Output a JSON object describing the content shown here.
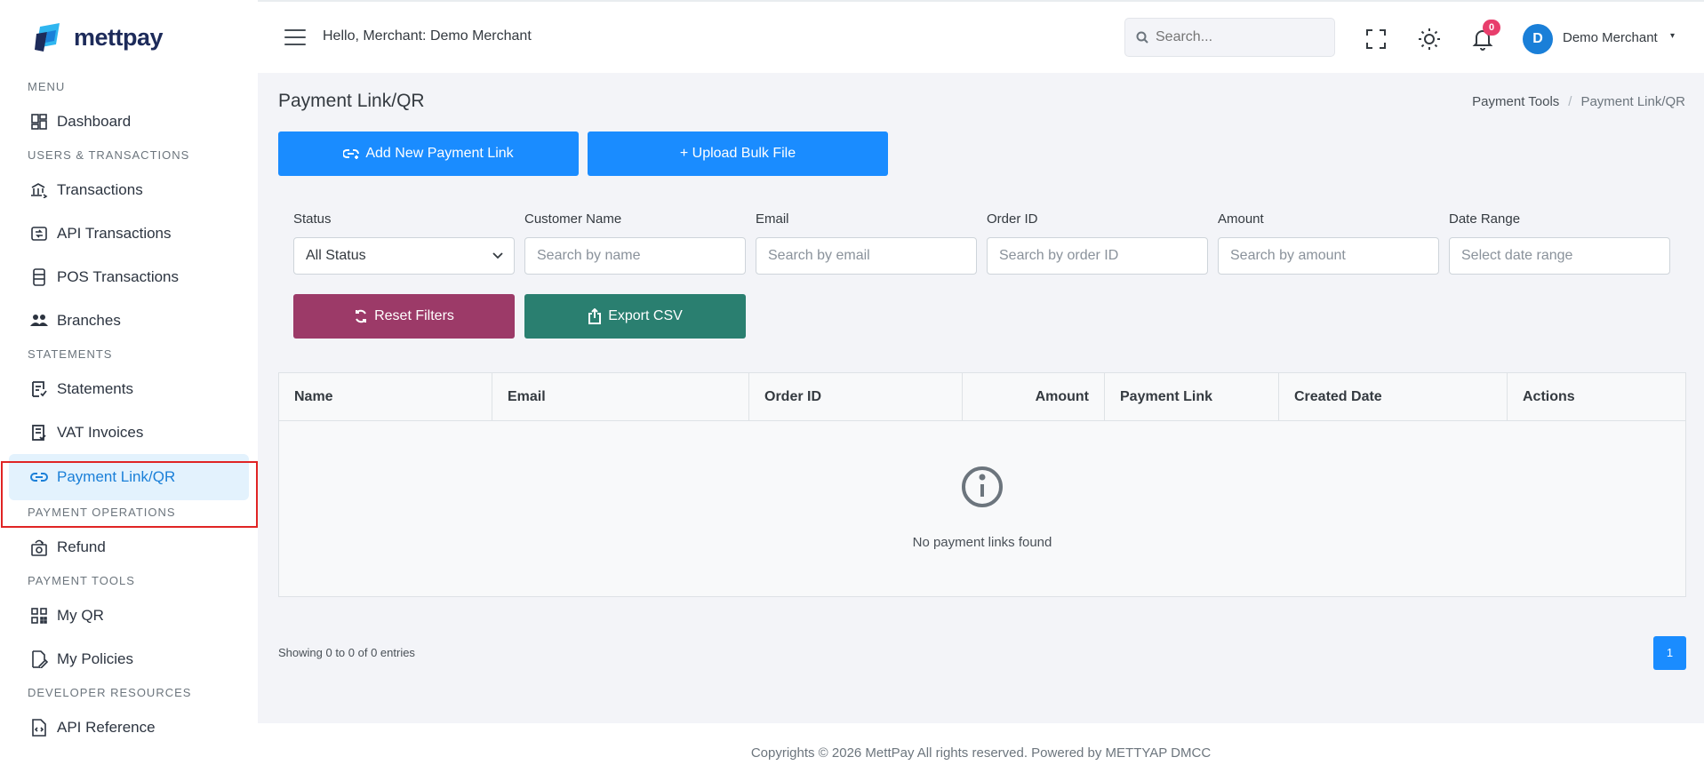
{
  "brand": {
    "name": "mettpay"
  },
  "sidebar": {
    "sections": {
      "menu": "MENU",
      "users": "USERS & TRANSACTIONS",
      "statements": "STATEMENTS",
      "payment_ops": "PAYMENT OPERATIONS",
      "payment_tools": "PAYMENT TOOLS",
      "developer": "DEVELOPER RESOURCES"
    },
    "items": {
      "dashboard": "Dashboard",
      "transactions": "Transactions",
      "api_transactions": "API Transactions",
      "pos_transactions": "POS Transactions",
      "branches": "Branches",
      "statements": "Statements",
      "vat_invoices": "VAT Invoices",
      "payment_link": "Payment Link/QR",
      "refund": "Refund",
      "my_qr": "My QR",
      "my_policies": "My Policies",
      "api_reference": "API Reference"
    },
    "active": "payment_link"
  },
  "topbar": {
    "greeting": "Hello, Merchant: Demo Merchant",
    "search_placeholder": "Search...",
    "notification_count": "0",
    "avatar_initial": "D",
    "user_name": "Demo Merchant"
  },
  "page": {
    "title": "Payment Link/QR",
    "breadcrumb": [
      "Payment Tools",
      "Payment Link/QR"
    ],
    "breadcrumb_sep": "/"
  },
  "actions": {
    "add_link": "Add New Payment Link",
    "upload_bulk": "+ Upload Bulk File",
    "reset_filters": "Reset Filters",
    "export_csv": "Export CSV"
  },
  "filters": {
    "status": {
      "label": "Status",
      "value": "All Status"
    },
    "customer": {
      "label": "Customer Name",
      "placeholder": "Search by name"
    },
    "email": {
      "label": "Email",
      "placeholder": "Search by email"
    },
    "order": {
      "label": "Order ID",
      "placeholder": "Search by order ID"
    },
    "amount": {
      "label": "Amount",
      "placeholder": "Search by amount"
    },
    "date": {
      "label": "Date Range",
      "placeholder": "Select date range"
    }
  },
  "table": {
    "columns": [
      "Name",
      "Email",
      "Order ID",
      "Amount",
      "Payment Link",
      "Created Date",
      "Actions"
    ],
    "empty_message": "No payment links found"
  },
  "pagination": {
    "summary": "Showing 0 to 0 of 0 entries",
    "current_page": "1"
  },
  "footer": {
    "text": "Copyrights © 2026 MettPay All rights reserved. Powered by METTYAP DMCC"
  },
  "colors": {
    "primary": "#1a8cff",
    "reset": "#9c3a68",
    "export": "#2a7f70",
    "active_bg": "#e3f2fd",
    "badge": "#e83e6c"
  }
}
